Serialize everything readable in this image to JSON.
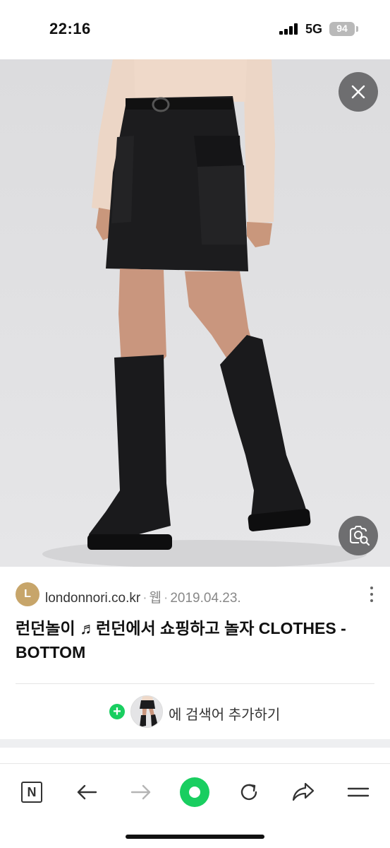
{
  "status_bar": {
    "time": "22:16",
    "network": "5G",
    "battery": "94"
  },
  "image": {
    "subject": "black mini cargo skirt with knee-high black boots",
    "close_icon": "close-icon",
    "lens_icon": "visual-search-icon"
  },
  "result": {
    "favicon_letter": "L",
    "domain": "londonnori.co.kr",
    "type": "웹",
    "date": "2019.04.23.",
    "title": "런던놀이 ♬런던에서 쇼핑하고 놀자 CLOTHES - BOTTOM"
  },
  "add_keyword": {
    "label": "에 검색어 추가하기"
  },
  "toolbar": {
    "n_label": "N"
  },
  "colors": {
    "accent_green": "#19ce60",
    "overlay_button": "#6e6e70",
    "favicon": "#c7a56a"
  }
}
